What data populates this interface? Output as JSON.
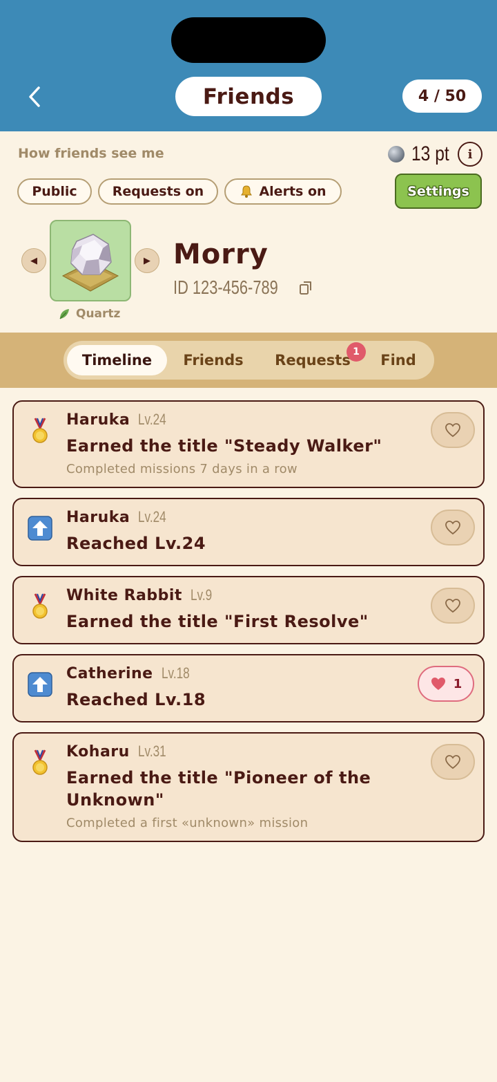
{
  "header": {
    "title": "Friends",
    "friend_count": "4 / 50",
    "back_icon": "chevron-left-icon"
  },
  "profile": {
    "see_me_label": "How friends see me",
    "points": "13 pt",
    "info_icon": "i",
    "chips": {
      "public": "Public",
      "requests": "Requests on",
      "alerts": "Alerts on"
    },
    "settings_label": "Settings",
    "avatar_name": "Quartz",
    "username": "Morry",
    "user_id": "ID 123-456-789",
    "prev_arrow": "◀",
    "next_arrow": "▶"
  },
  "tabs": {
    "timeline": "Timeline",
    "friends": "Friends",
    "requests": "Requests",
    "find": "Find",
    "requests_badge": "1",
    "active": "Timeline"
  },
  "feed": [
    {
      "icon": "medal-icon",
      "name": "Haruka",
      "level": "Lv.24",
      "text": "Earned the title \"Steady Walker\"",
      "sub": "Completed missions 7 days in a row",
      "likes": "",
      "liked": false
    },
    {
      "icon": "level-up-icon",
      "name": "Haruka",
      "level": "Lv.24",
      "text": "Reached Lv.24",
      "sub": "",
      "likes": "",
      "liked": false
    },
    {
      "icon": "medal-icon",
      "name": "White Rabbit",
      "level": "Lv.9",
      "text": "Earned the title \"First Resolve\"",
      "sub": "",
      "likes": "",
      "liked": false
    },
    {
      "icon": "level-up-icon",
      "name": "Catherine",
      "level": "Lv.18",
      "text": "Reached Lv.18",
      "sub": "",
      "likes": "1",
      "liked": true
    },
    {
      "icon": "medal-icon",
      "name": "Koharu",
      "level": "Lv.31",
      "text": "Earned the title \"Pioneer of the Unknown\"",
      "sub": "Completed a first «unknown» mission",
      "likes": "",
      "liked": false
    }
  ],
  "colors": {
    "header_bg": "#3d8ab7",
    "page_bg": "#fbf3e4",
    "text_dark": "#4a1a14",
    "settings_green": "#8cc34f",
    "tab_band": "#d5b378",
    "badge": "#e05a6a",
    "liked_heart": "#e05a6a"
  }
}
